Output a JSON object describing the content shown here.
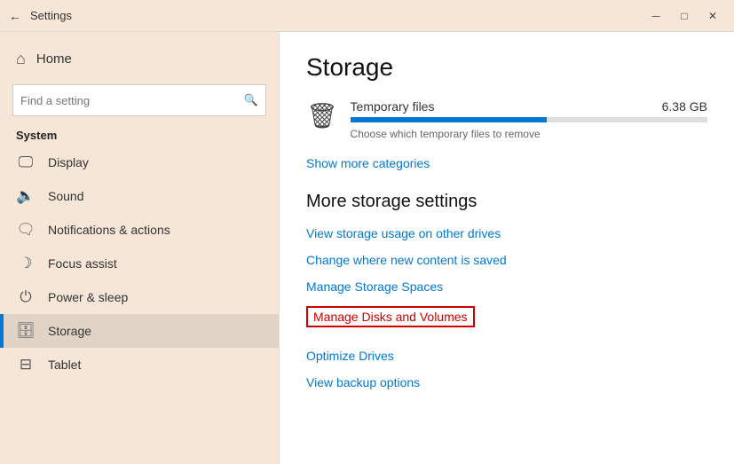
{
  "titlebar": {
    "back_icon": "←",
    "title": "Settings",
    "minimize_icon": "─",
    "restore_icon": "□",
    "close_icon": "✕"
  },
  "sidebar": {
    "home_label": "Home",
    "search_placeholder": "Find a setting",
    "section_title": "System",
    "items": [
      {
        "id": "display",
        "label": "Display",
        "icon": "🖥"
      },
      {
        "id": "sound",
        "label": "Sound",
        "icon": "🔊"
      },
      {
        "id": "notifications",
        "label": "Notifications & actions",
        "icon": "🗨"
      },
      {
        "id": "focus",
        "label": "Focus assist",
        "icon": "☽"
      },
      {
        "id": "power",
        "label": "Power & sleep",
        "icon": "⏻"
      },
      {
        "id": "storage",
        "label": "Storage",
        "icon": "💾",
        "active": true
      },
      {
        "id": "tablet",
        "label": "Tablet",
        "icon": "📱"
      }
    ]
  },
  "content": {
    "title": "Storage",
    "storage_item": {
      "name": "Temporary files",
      "size": "6.38 GB",
      "description": "Choose which temporary files to remove",
      "progress_percent": 55
    },
    "show_more_label": "Show more categories",
    "more_settings_title": "More storage settings",
    "links": [
      {
        "id": "view-usage",
        "label": "View storage usage on other drives",
        "highlighted": false
      },
      {
        "id": "change-location",
        "label": "Change where new content is saved",
        "highlighted": false
      },
      {
        "id": "manage-spaces",
        "label": "Manage Storage Spaces",
        "highlighted": false
      },
      {
        "id": "manage-disks",
        "label": "Manage Disks and Volumes",
        "highlighted": true
      },
      {
        "id": "optimize",
        "label": "Optimize Drives",
        "highlighted": false
      },
      {
        "id": "backup",
        "label": "View backup options",
        "highlighted": false
      }
    ]
  }
}
